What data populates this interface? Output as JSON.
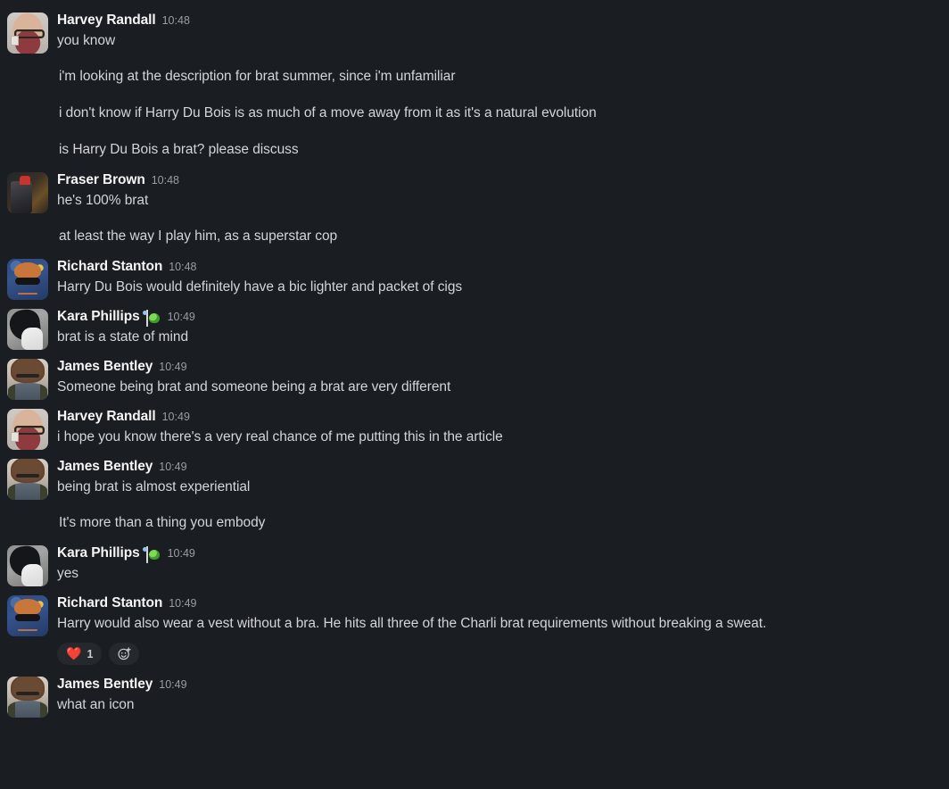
{
  "app": {
    "name": "Slack",
    "theme": "dark",
    "background_color": "#1a1d21"
  },
  "colors": {
    "background": "#1a1d21",
    "username": "#f5f5f5",
    "message_text": "#d2d5d9",
    "timestamp": "#9a9da1",
    "reaction_pill_bg": "#25282c",
    "heart_red": "#e8413c"
  },
  "messages": [
    {
      "author": "Harvey Randall",
      "time": "10:48",
      "avatar": "harvey-randall-avatar",
      "status_emoji": null,
      "first": true,
      "lines": [
        {
          "text": "you know"
        },
        {
          "text": "i'm looking at the description for brat summer, since i'm unfamiliar"
        },
        {
          "text": "i don't know if Harry Du Bois is as much of a move away from it as it's a natural evolution"
        },
        {
          "text": "is Harry Du Bois a brat? please discuss"
        }
      ],
      "reactions": []
    },
    {
      "author": "Fraser Brown",
      "time": "10:48",
      "avatar": "fraser-brown-avatar",
      "status_emoji": null,
      "first": false,
      "lines": [
        {
          "text": "he's 100% brat"
        },
        {
          "text": "at least the way I play him, as a superstar cop"
        }
      ],
      "reactions": []
    },
    {
      "author": "Richard Stanton",
      "time": "10:48",
      "avatar": "richard-stanton-avatar",
      "status_emoji": null,
      "first": false,
      "lines": [
        {
          "text": "Harry Du Bois would definitely have a bic lighter and packet of cigs"
        }
      ],
      "reactions": []
    },
    {
      "author": "Kara Phillips",
      "time": "10:49",
      "avatar": "kara-phillips-avatar",
      "status_emoji": "green-creature-status-emoji",
      "first": false,
      "lines": [
        {
          "text": "brat is a state of mind"
        }
      ],
      "reactions": []
    },
    {
      "author": "James Bentley",
      "time": "10:49",
      "avatar": "james-bentley-avatar",
      "status_emoji": null,
      "first": false,
      "lines": [
        {
          "html": "Someone being brat and someone being <em>a</em> brat are very different"
        }
      ],
      "reactions": []
    },
    {
      "author": "Harvey Randall",
      "time": "10:49",
      "avatar": "harvey-randall-avatar",
      "status_emoji": null,
      "first": false,
      "lines": [
        {
          "text": "i hope you know there's a very real chance of me putting this in the article"
        }
      ],
      "reactions": []
    },
    {
      "author": "James Bentley",
      "time": "10:49",
      "avatar": "james-bentley-avatar",
      "status_emoji": null,
      "first": false,
      "lines": [
        {
          "text": "being brat is almost experiential"
        },
        {
          "text": "It's more than a thing you embody"
        }
      ],
      "reactions": []
    },
    {
      "author": "Kara Phillips",
      "time": "10:49",
      "avatar": "kara-phillips-avatar",
      "status_emoji": "green-creature-status-emoji",
      "first": false,
      "lines": [
        {
          "text": "yes"
        }
      ],
      "reactions": []
    },
    {
      "author": "Richard Stanton",
      "time": "10:49",
      "avatar": "richard-stanton-avatar",
      "status_emoji": null,
      "first": false,
      "lines": [
        {
          "text": "Harry would also wear a vest without a bra. He hits all three of the Charli brat requirements without breaking a sweat."
        }
      ],
      "reactions": [
        {
          "emoji": "❤️",
          "name": "heart-reaction",
          "count": "1"
        }
      ],
      "has_add_reaction": true,
      "add_reaction_icon": "add-reaction-icon"
    },
    {
      "author": "James Bentley",
      "time": "10:49",
      "avatar": "james-bentley-avatar",
      "status_emoji": null,
      "first": false,
      "lines": [
        {
          "text": "what an icon"
        }
      ],
      "reactions": []
    }
  ]
}
